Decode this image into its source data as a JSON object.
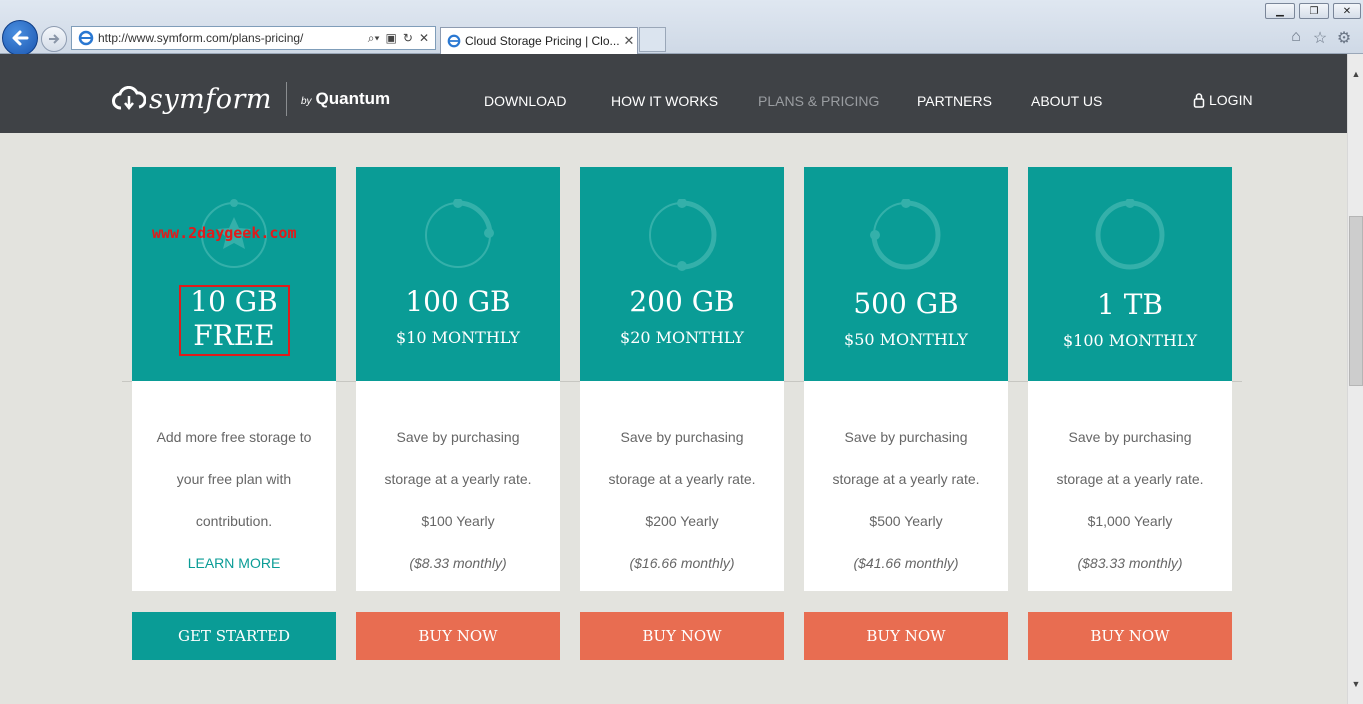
{
  "browser": {
    "url": "http://www.symform.com/plans-pricing/",
    "tab_title": "Cloud Storage Pricing | Clo...",
    "window_controls": [
      "minimize",
      "restore",
      "close"
    ],
    "tools": [
      "home-icon",
      "star-icon",
      "gear-icon"
    ]
  },
  "header": {
    "logo_word": "symform",
    "logo_by": "by",
    "logo_company": "Quantum",
    "nav": [
      "DOWNLOAD",
      "HOW IT WORKS",
      "PLANS & PRICING",
      "PARTNERS",
      "ABOUT US"
    ],
    "active_nav": "PLANS & PRICING",
    "login": "LOGIN"
  },
  "watermark": "www.2daygeek.com",
  "colors": {
    "teal": "#0a9c96",
    "orange": "#e86d51",
    "header": "#3f4246",
    "annotation": "#e11b1b"
  },
  "plans": [
    {
      "title_line1": "10 GB",
      "title_line2": "FREE",
      "price": "",
      "lines": [
        "Add more free storage to",
        "your free plan with",
        "contribution."
      ],
      "extra": "",
      "link": "LEARN MORE",
      "button": "GET STARTED"
    },
    {
      "title_line1": "100 GB",
      "price": "$10 MONTHLY",
      "lines": [
        "Save by purchasing",
        "storage at a yearly rate.",
        "$100 Yearly"
      ],
      "extra": "($8.33 monthly)",
      "button": "BUY NOW"
    },
    {
      "title_line1": "200 GB",
      "price": "$20 MONTHLY",
      "lines": [
        "Save by purchasing",
        "storage at a yearly rate.",
        "$200 Yearly"
      ],
      "extra": "($16.66 monthly)",
      "button": "BUY NOW"
    },
    {
      "title_line1": "500 GB",
      "price": "$50 MONTHLY",
      "lines": [
        "Save by purchasing",
        "storage at a yearly rate.",
        "$500 Yearly"
      ],
      "extra": "($41.66 monthly)",
      "button": "BUY NOW"
    },
    {
      "title_line1": "1 TB",
      "price": "$100 MONTHLY",
      "lines": [
        "Save by purchasing",
        "storage at a yearly rate.",
        "$1,000 Yearly"
      ],
      "extra": "($83.33 monthly)",
      "button": "BUY NOW"
    }
  ]
}
